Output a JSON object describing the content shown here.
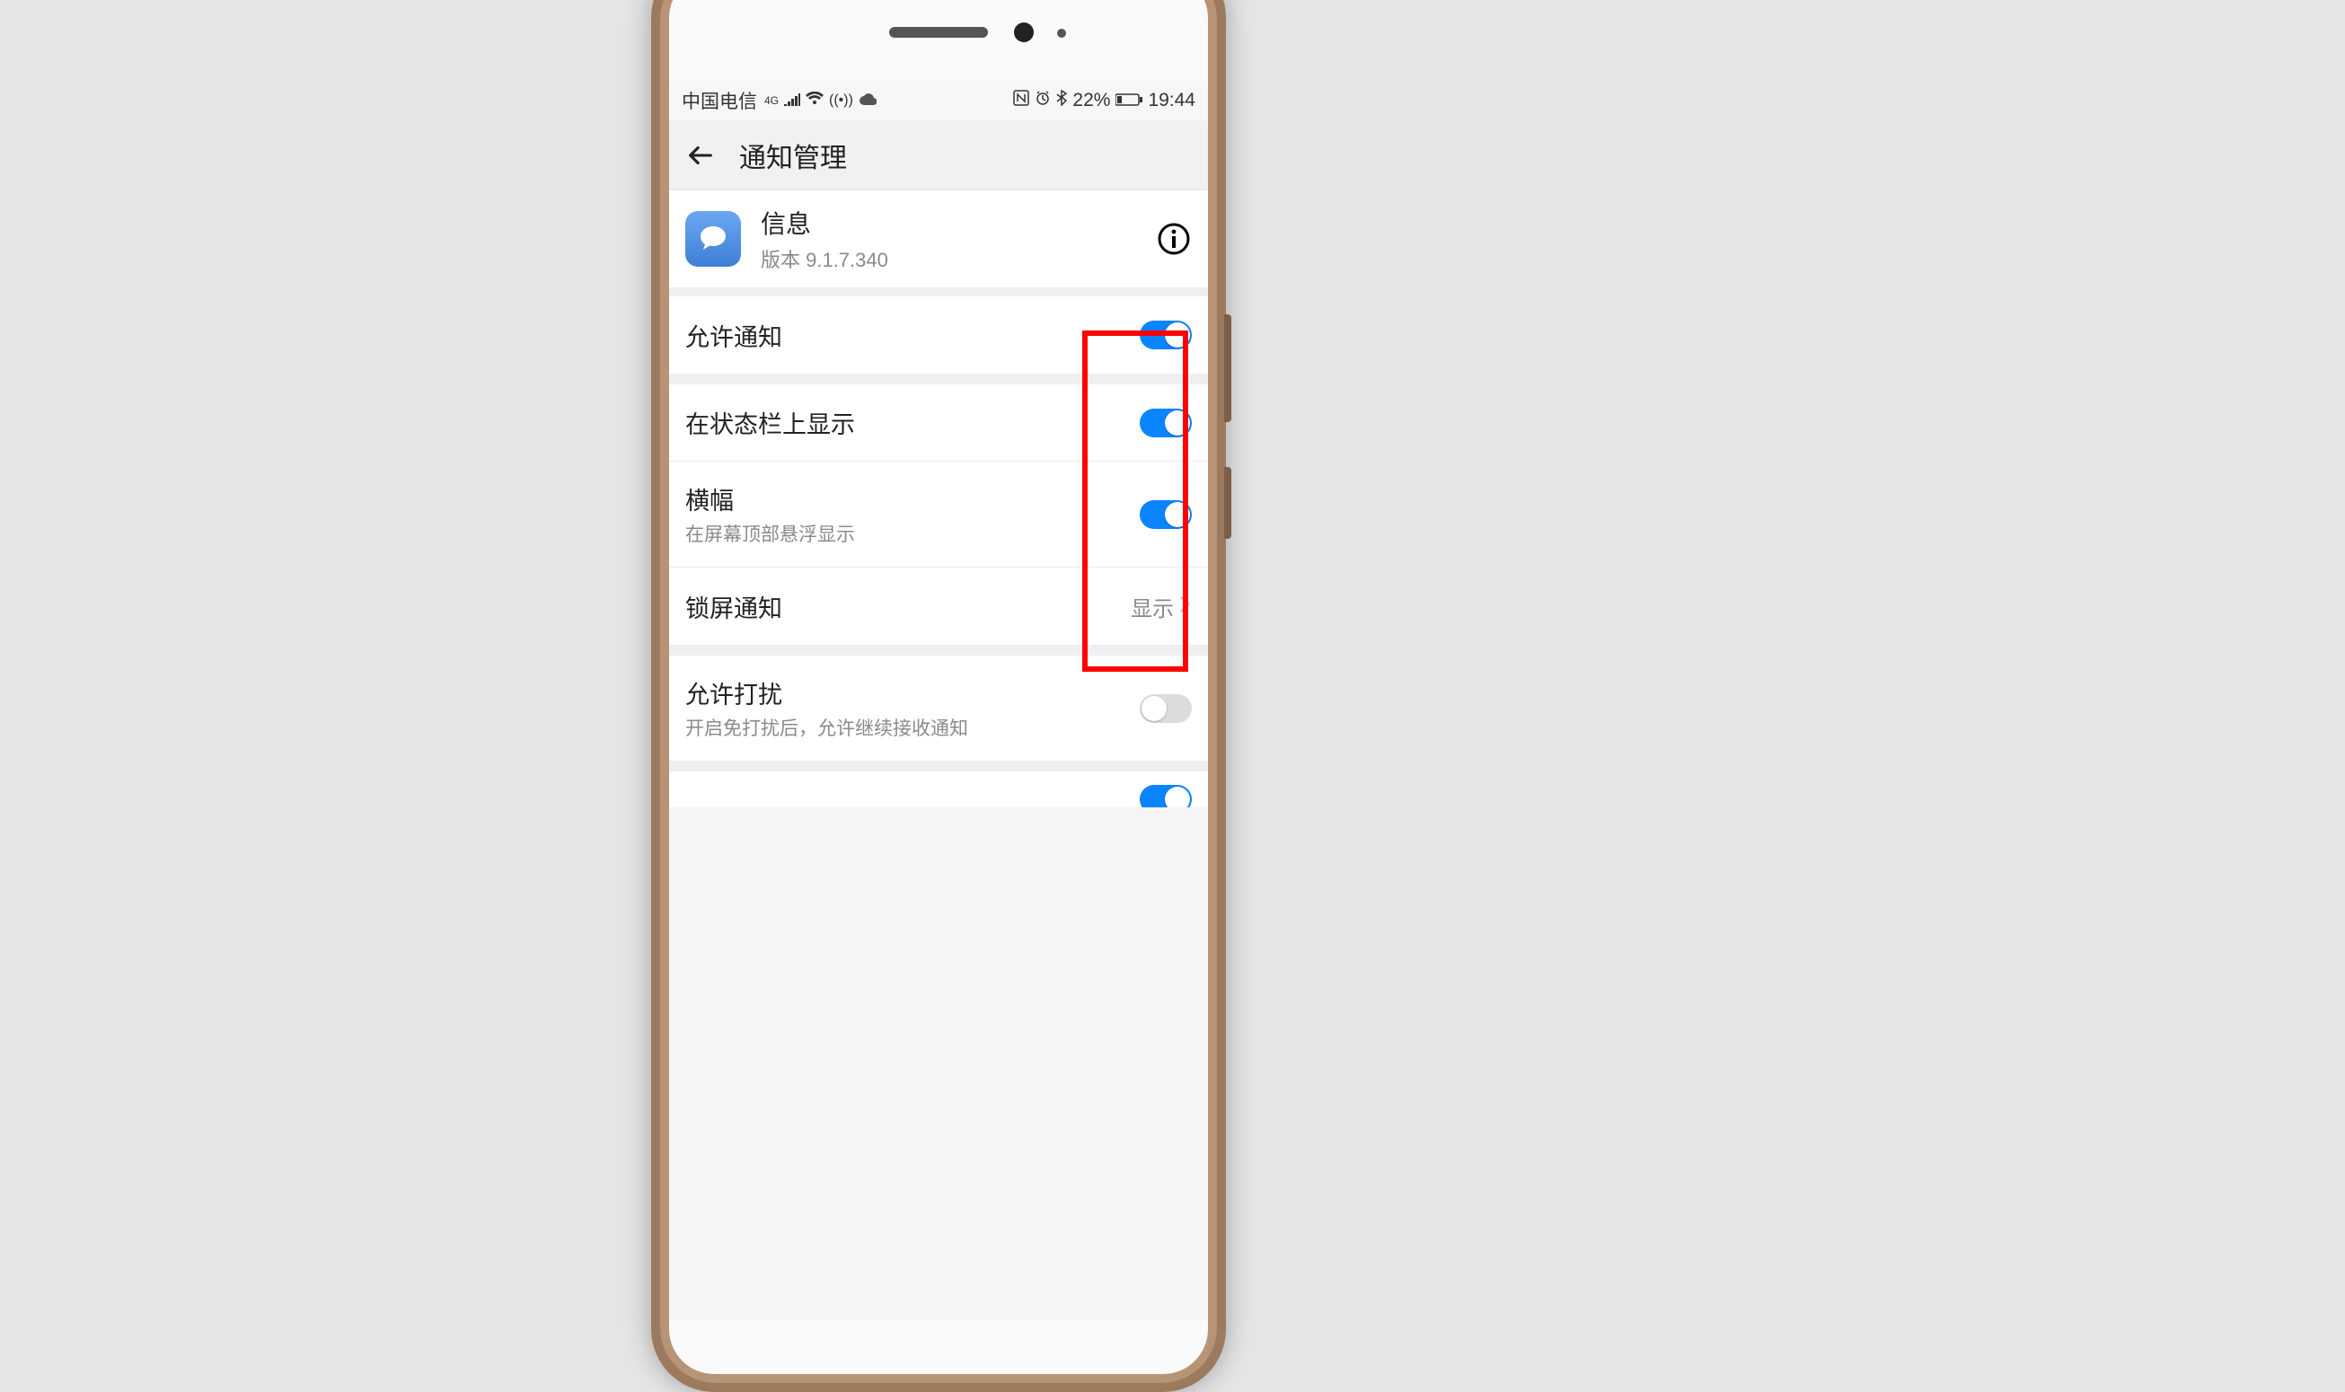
{
  "statusbar": {
    "carrier": "中国电信",
    "network_badge": "4G",
    "battery_text": "22%",
    "time": "19:44"
  },
  "titlebar": {
    "title": "通知管理"
  },
  "app": {
    "name": "信息",
    "version": "版本 9.1.7.340"
  },
  "rows": {
    "allow_notifications": {
      "label": "允许通知",
      "on": true
    },
    "statusbar_display": {
      "label": "在状态栏上显示",
      "on": true
    },
    "banner": {
      "label": "横幅",
      "sub": "在屏幕顶部悬浮显示",
      "on": true
    },
    "lockscreen": {
      "label": "锁屏通知",
      "value": "显示"
    },
    "allow_disturb": {
      "label": "允许打扰",
      "sub": "开启免打扰后，允许继续接收通知",
      "on": false
    }
  }
}
